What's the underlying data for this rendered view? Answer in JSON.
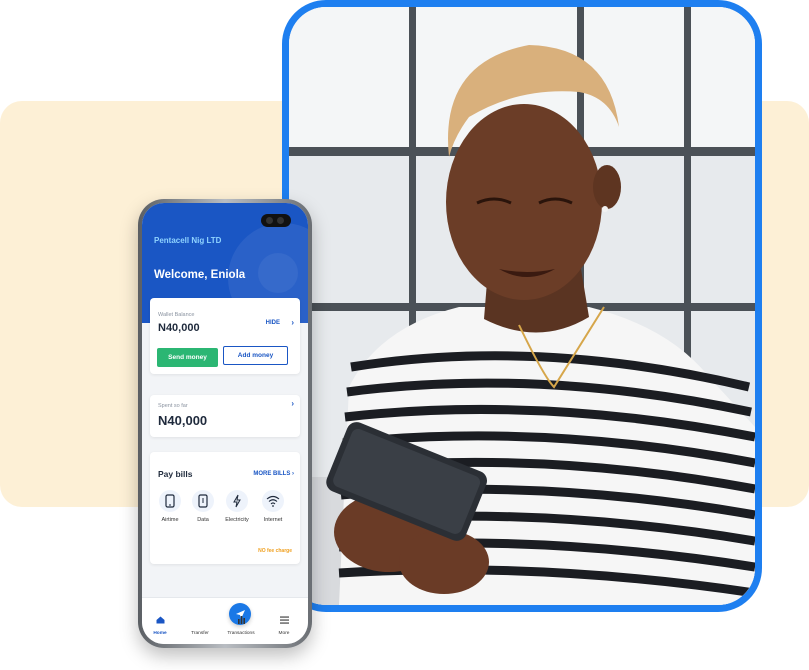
{
  "app": {
    "company": "Pentacell Nig LTD",
    "welcome": "Welcome, Eniola"
  },
  "wallet": {
    "label": "Wallet Balance",
    "amount": "N40,000",
    "hide_label": "HIDE",
    "send_label": "Send money",
    "add_label": "Add money"
  },
  "spent": {
    "label": "Spent so far",
    "amount": "N40,000"
  },
  "bills": {
    "title": "Pay bills",
    "more_label": "MORE BILLS",
    "items": [
      {
        "label": "Airtime",
        "icon": "phone-icon"
      },
      {
        "label": "Data",
        "icon": "data-icon"
      },
      {
        "label": "Electricity",
        "icon": "lightning-icon"
      },
      {
        "label": "Internet",
        "icon": "wifi-icon"
      }
    ],
    "fee_note": "NO fee charge"
  },
  "tabs": [
    {
      "label": "Home",
      "icon": "home-icon"
    },
    {
      "label": "Transfer",
      "icon": "send-icon"
    },
    {
      "label": "Transactions",
      "icon": "bar-chart-icon"
    },
    {
      "label": "More",
      "icon": "menu-icon"
    }
  ],
  "colors": {
    "brand_blue": "#1a56c4",
    "frame_blue": "#1e7ff0",
    "send_green": "#2bb673",
    "panel_cream": "#fdf0d6"
  }
}
